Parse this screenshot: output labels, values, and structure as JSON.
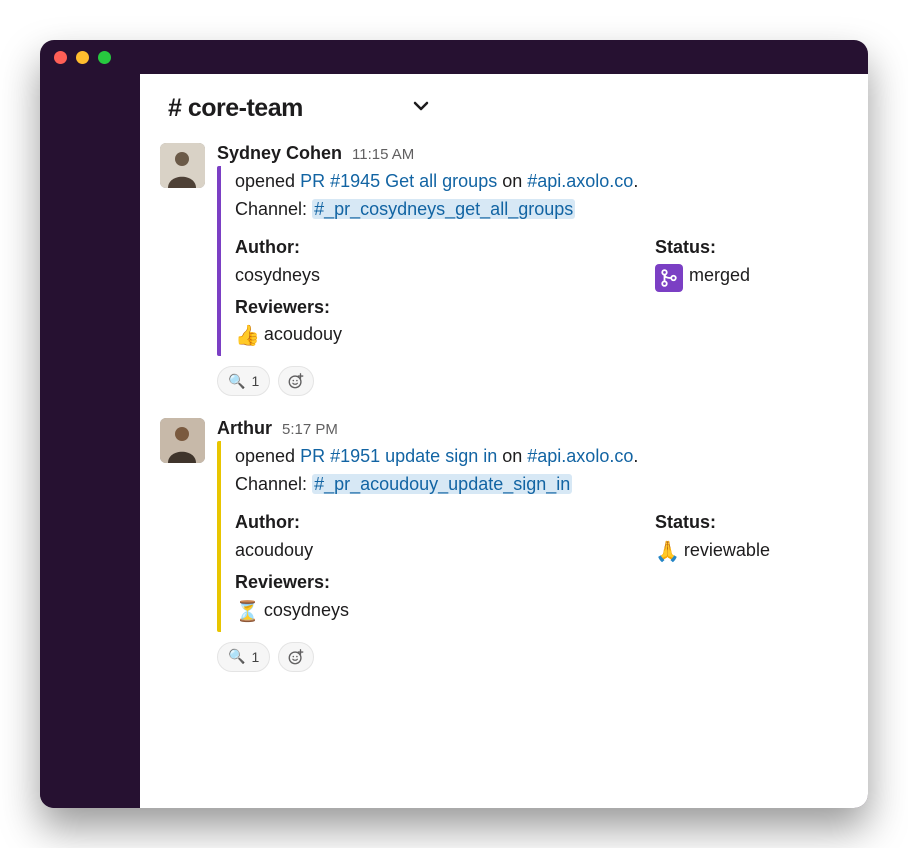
{
  "channel": {
    "name": "# core-team"
  },
  "messages": [
    {
      "author": "Sydney Cohen",
      "time": "11:15 AM",
      "accent": "purple",
      "opened_prefix": "opened ",
      "pr_link": "PR #1945 Get all groups",
      "opened_mid": " on ",
      "repo": "#api.axolo.co",
      "opened_suffix": ".",
      "channel_label": "Channel: ",
      "pr_channel": "#_pr_cosydneys_get_all_groups",
      "author_label": "Author:",
      "author_value": "cosydneys",
      "reviewers_label": "Reviewers:",
      "reviewer_emoji": "👍",
      "reviewer_value": "acoudouy",
      "status_label": "Status:",
      "status_icon": "merge",
      "status_value": "merged",
      "reaction_emoji": "🔍",
      "reaction_count": "1"
    },
    {
      "author": "Arthur",
      "time": "5:17 PM",
      "accent": "yellow",
      "opened_prefix": "opened ",
      "pr_link": "PR #1951 update sign in",
      "opened_mid": " on ",
      "repo": "#api.axolo.co",
      "opened_suffix": ".",
      "channel_label": "Channel: ",
      "pr_channel": "#_pr_acoudouy_update_sign_in",
      "author_label": "Author:",
      "author_value": "acoudouy",
      "reviewers_label": "Reviewers:",
      "reviewer_emoji": "⏳",
      "reviewer_value": "cosydneys",
      "status_label": "Status:",
      "status_emoji": "🙏",
      "status_value": "reviewable",
      "reaction_emoji": "🔍",
      "reaction_count": "1"
    }
  ]
}
